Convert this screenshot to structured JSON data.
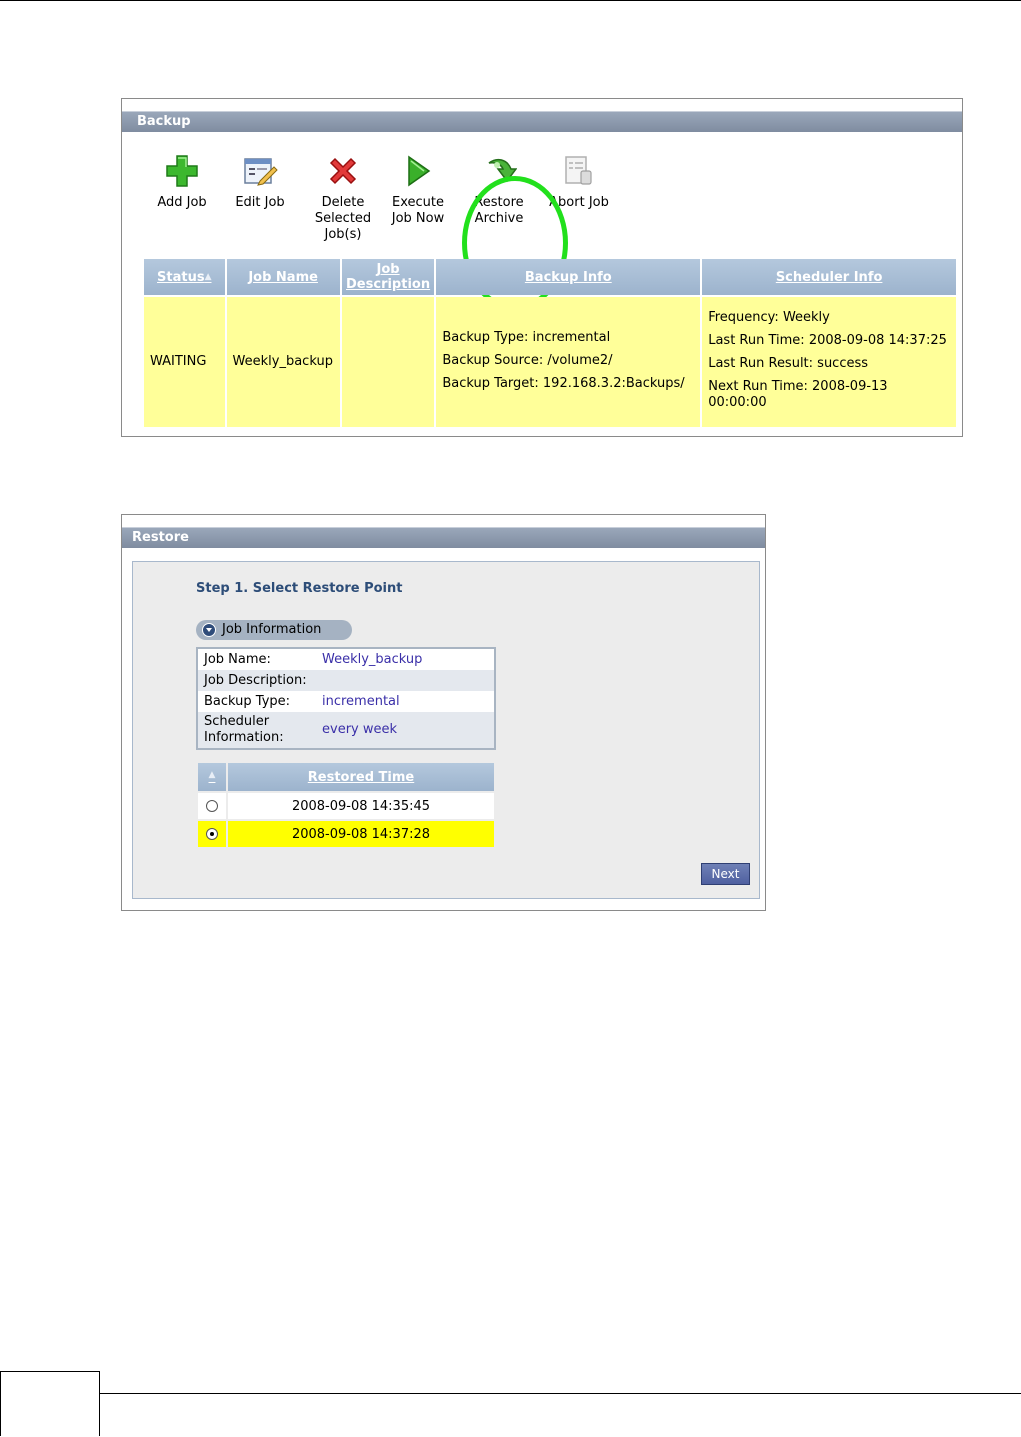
{
  "backup": {
    "title": "Backup",
    "toolbar": [
      {
        "label": "Add Job",
        "icon": "plus-icon"
      },
      {
        "label": "Edit Job",
        "icon": "edit-job-icon"
      },
      {
        "label": "Delete Selected Job(s)",
        "icon": "delete-icon"
      },
      {
        "label": "Execute Job Now",
        "icon": "play-icon"
      },
      {
        "label": "Restore Archive",
        "icon": "restore-arrow-icon"
      },
      {
        "label": "Abort Job",
        "icon": "abort-job-icon"
      }
    ],
    "columns": [
      "Status",
      "Job Name",
      "Job Description",
      "Backup Info",
      "Scheduler Info"
    ],
    "row": {
      "status": "WAITING",
      "job_name": "Weekly_backup",
      "job_description": "",
      "backup_info": [
        "Backup Type: incremental",
        "Backup Source: /volume2/",
        "Backup Target: 192.168.3.2:Backups/"
      ],
      "scheduler_info": [
        "Frequency: Weekly",
        "Last Run Time: 2008-09-08 14:37:25",
        "Last Run Result: success",
        "Next Run Time: 2008-09-13 00:00:00"
      ]
    }
  },
  "restore": {
    "title": "Restore",
    "step_title": "Step 1. Select Restore Point",
    "job_info_label": "Job Information",
    "job_info": [
      {
        "label": "Job Name:",
        "value": "Weekly_backup"
      },
      {
        "label": "Job Description:",
        "value": ""
      },
      {
        "label": "Backup Type:",
        "value": "incremental"
      },
      {
        "label": "Scheduler Information:",
        "value": "every week"
      }
    ],
    "restored_time_header": "Restored Time",
    "restore_points": [
      {
        "time": "2008-09-08 14:35:45",
        "selected": false
      },
      {
        "time": "2008-09-08 14:37:28",
        "selected": true
      }
    ],
    "next_label": "Next"
  },
  "colors": {
    "highlight_ring": "#22e01c",
    "row_highlight": "#ffff99",
    "selected_row": "#ffff00"
  }
}
